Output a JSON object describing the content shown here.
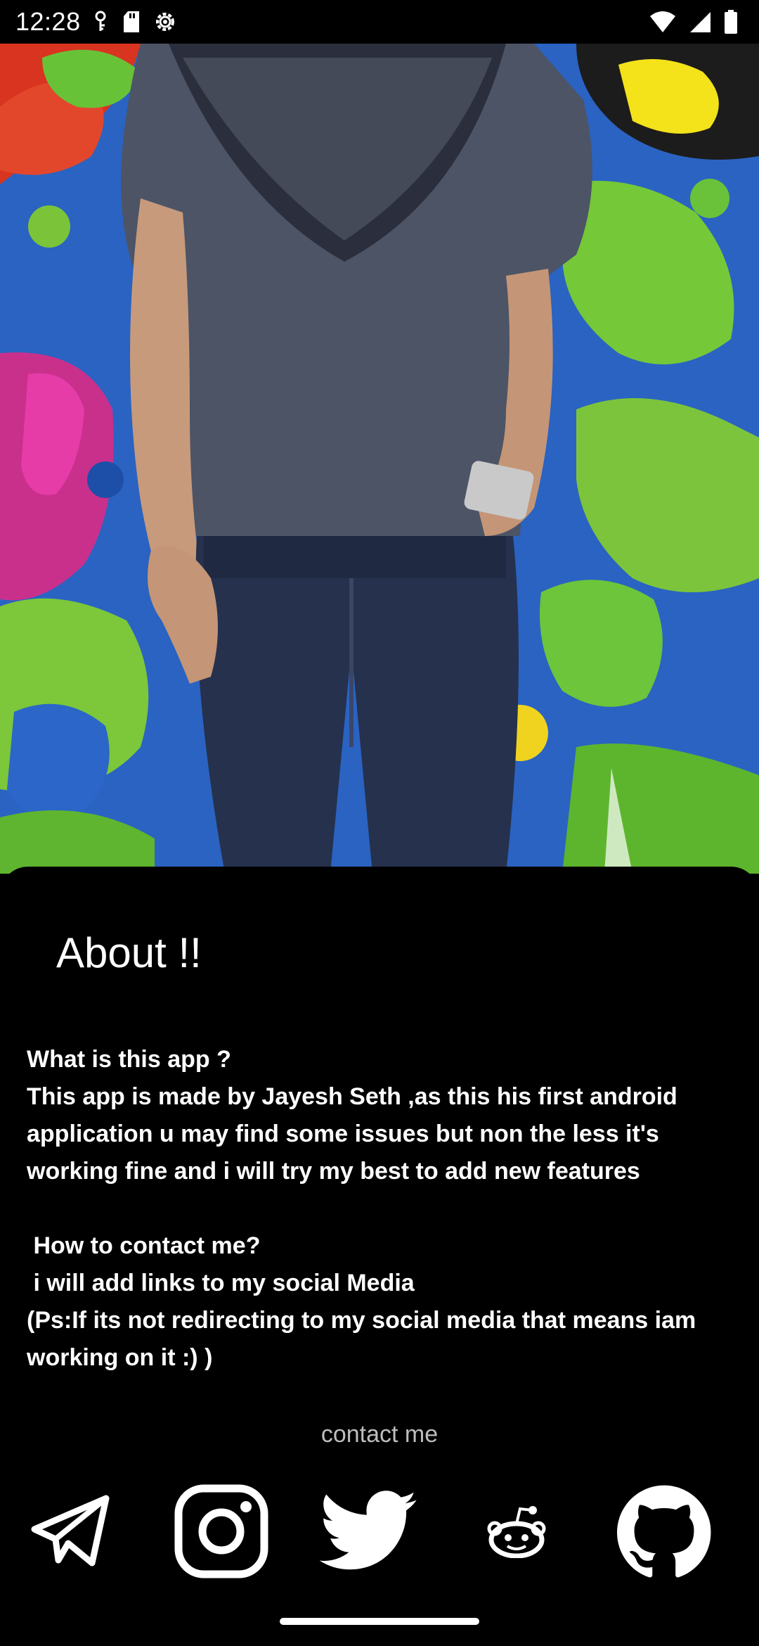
{
  "status_bar": {
    "time": "12:28",
    "left_icons": [
      "vpn-key-icon",
      "sd-card-icon",
      "settings-gear-icon"
    ],
    "right_icons": [
      "wifi-icon",
      "cellular-signal-icon",
      "battery-icon"
    ]
  },
  "hero": {
    "image": "person-standing-against-graffiti-wall-photo"
  },
  "about": {
    "title": "About !!",
    "q1": "What is this app ?",
    "a1": "This app is made by Jayesh Seth ,as this his first android application u may find some issues but non the less it's working fine and i will try my best to add new features",
    "q2": " How to contact me?",
    "a2": " i will add links to my social Media",
    "ps": "(Ps:If its not redirecting to my social media that means iam working on it :) )"
  },
  "contact": {
    "label": "contact me",
    "links": [
      {
        "name": "telegram",
        "icon": "telegram-icon"
      },
      {
        "name": "instagram",
        "icon": "instagram-icon"
      },
      {
        "name": "twitter",
        "icon": "twitter-icon"
      },
      {
        "name": "reddit",
        "icon": "reddit-icon"
      },
      {
        "name": "github",
        "icon": "github-icon"
      }
    ]
  },
  "colors": {
    "background": "#000000",
    "text": "#ffffff",
    "muted_text": "#bdbdbd"
  }
}
